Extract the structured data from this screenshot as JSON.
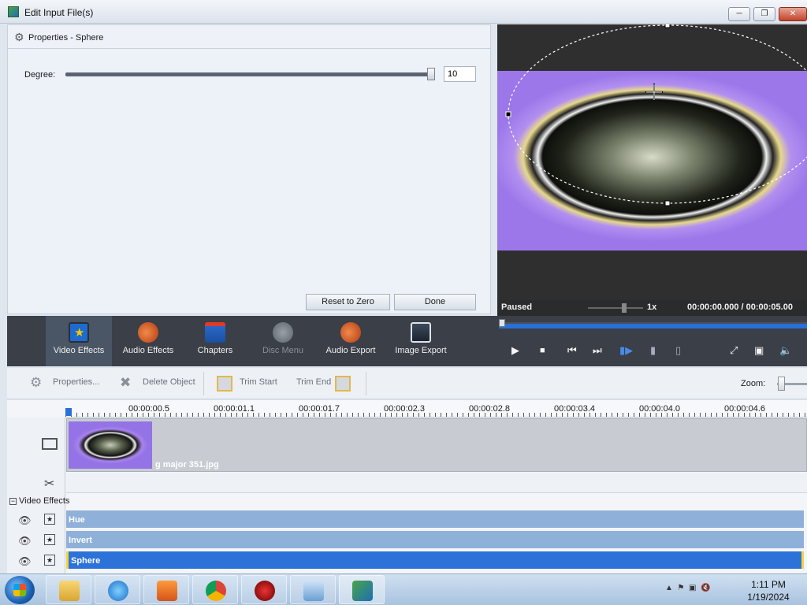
{
  "window": {
    "title": "Edit Input File(s)"
  },
  "properties": {
    "title": "Properties - Sphere",
    "degree_label": "Degree:",
    "degree_value": "10",
    "degree_slider": 1.0,
    "reset_label": "Reset to Zero",
    "done_label": "Done"
  },
  "preview": {
    "status": "Paused",
    "speed": "1x",
    "time": "00:00:00.000  /  00:00:05.00"
  },
  "toolbar": {
    "items": [
      {
        "label": "Video Effects",
        "icon": "star-icon",
        "active": true
      },
      {
        "label": "Audio Effects",
        "icon": "speaker-star-icon",
        "active": false
      },
      {
        "label": "Chapters",
        "icon": "bookmark-film-icon",
        "active": false
      },
      {
        "label": "Disc Menu",
        "icon": "disc-menu-icon",
        "active": false,
        "disabled": true
      },
      {
        "label": "Audio Export",
        "icon": "speaker-export-icon",
        "active": false
      },
      {
        "label": "Image Export",
        "icon": "image-export-icon",
        "active": false
      }
    ]
  },
  "actions": {
    "properties": "Properties...",
    "delete": "Delete Object",
    "trim_start": "Trim Start",
    "trim_end": "Trim End",
    "zoom": "Zoom:"
  },
  "timeline": {
    "ticks": [
      "00:00:00.5",
      "00:00:01.1",
      "00:00:01.7",
      "00:00:02.3",
      "00:00:02.8",
      "00:00:03.4",
      "00:00:04.0",
      "00:00:04.6"
    ],
    "clip_name": "g major 351.jpg",
    "section": "Video Effects",
    "effects": [
      "Hue",
      "Invert",
      "Sphere"
    ]
  },
  "taskbar": {
    "time": "1:11 PM",
    "date": "1/19/2024"
  },
  "colors": {
    "accent": "#2d72d9",
    "toolbar_bg": "#3a3f48",
    "effect_bar": "#8fb0d8"
  }
}
